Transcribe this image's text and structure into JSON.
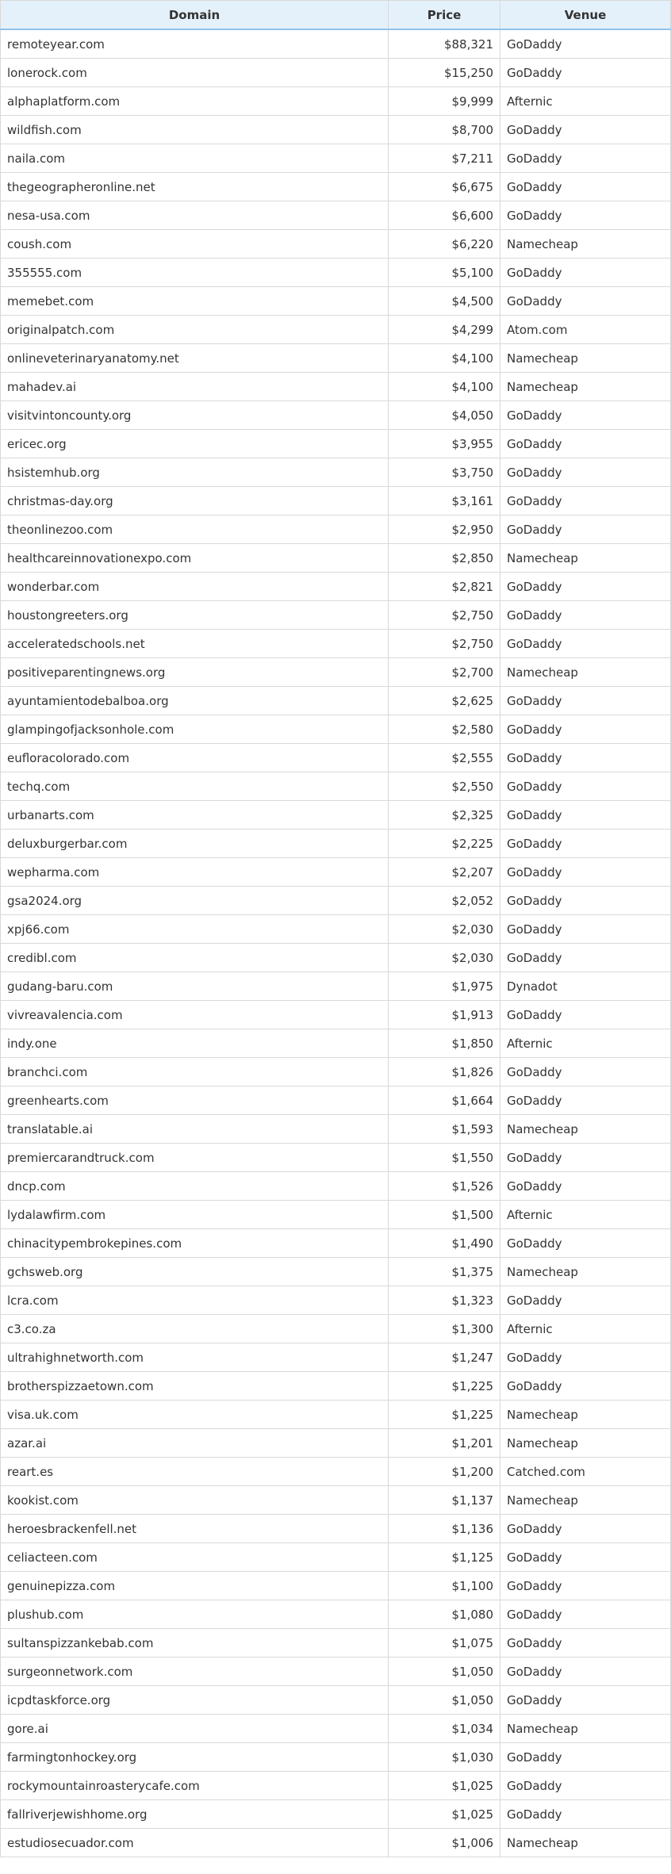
{
  "table": {
    "headers": {
      "domain": "Domain",
      "price": "Price",
      "venue": "Venue"
    },
    "rows": [
      {
        "domain": "remoteyear.com",
        "price": "$88,321",
        "venue": "GoDaddy"
      },
      {
        "domain": "lonerock.com",
        "price": "$15,250",
        "venue": "GoDaddy"
      },
      {
        "domain": "alphaplatform.com",
        "price": "$9,999",
        "venue": "Afternic"
      },
      {
        "domain": "wildfish.com",
        "price": "$8,700",
        "venue": "GoDaddy"
      },
      {
        "domain": "naila.com",
        "price": "$7,211",
        "venue": "GoDaddy"
      },
      {
        "domain": "thegeographeronline.net",
        "price": "$6,675",
        "venue": "GoDaddy"
      },
      {
        "domain": "nesa-usa.com",
        "price": "$6,600",
        "venue": "GoDaddy"
      },
      {
        "domain": "coush.com",
        "price": "$6,220",
        "venue": "Namecheap"
      },
      {
        "domain": "355555.com",
        "price": "$5,100",
        "venue": "GoDaddy"
      },
      {
        "domain": "memebet.com",
        "price": "$4,500",
        "venue": "GoDaddy"
      },
      {
        "domain": "originalpatch.com",
        "price": "$4,299",
        "venue": "Atom.com"
      },
      {
        "domain": "onlineveterinaryanatomy.net",
        "price": "$4,100",
        "venue": "Namecheap"
      },
      {
        "domain": "mahadev.ai",
        "price": "$4,100",
        "venue": "Namecheap"
      },
      {
        "domain": "visitvintoncounty.org",
        "price": "$4,050",
        "venue": "GoDaddy"
      },
      {
        "domain": "ericec.org",
        "price": "$3,955",
        "venue": "GoDaddy"
      },
      {
        "domain": "hsistemhub.org",
        "price": "$3,750",
        "venue": "GoDaddy"
      },
      {
        "domain": "christmas-day.org",
        "price": "$3,161",
        "venue": "GoDaddy"
      },
      {
        "domain": "theonlinezoo.com",
        "price": "$2,950",
        "venue": "GoDaddy"
      },
      {
        "domain": "healthcareinnovationexpo.com",
        "price": "$2,850",
        "venue": "Namecheap"
      },
      {
        "domain": "wonderbar.com",
        "price": "$2,821",
        "venue": "GoDaddy"
      },
      {
        "domain": "houstongreeters.org",
        "price": "$2,750",
        "venue": "GoDaddy"
      },
      {
        "domain": "acceleratedschools.net",
        "price": "$2,750",
        "venue": "GoDaddy"
      },
      {
        "domain": "positiveparentingnews.org",
        "price": "$2,700",
        "venue": "Namecheap"
      },
      {
        "domain": "ayuntamientodebalboa.org",
        "price": "$2,625",
        "venue": "GoDaddy"
      },
      {
        "domain": "glampingofjacksonhole.com",
        "price": "$2,580",
        "venue": "GoDaddy"
      },
      {
        "domain": "eufloracolorado.com",
        "price": "$2,555",
        "venue": "GoDaddy"
      },
      {
        "domain": "techq.com",
        "price": "$2,550",
        "venue": "GoDaddy"
      },
      {
        "domain": "urbanarts.com",
        "price": "$2,325",
        "venue": "GoDaddy"
      },
      {
        "domain": "deluxburgerbar.com",
        "price": "$2,225",
        "venue": "GoDaddy"
      },
      {
        "domain": "wepharma.com",
        "price": "$2,207",
        "venue": "GoDaddy"
      },
      {
        "domain": "gsa2024.org",
        "price": "$2,052",
        "venue": "GoDaddy"
      },
      {
        "domain": "xpj66.com",
        "price": "$2,030",
        "venue": "GoDaddy"
      },
      {
        "domain": "credibl.com",
        "price": "$2,030",
        "venue": "GoDaddy"
      },
      {
        "domain": "gudang-baru.com",
        "price": "$1,975",
        "venue": "Dynadot"
      },
      {
        "domain": "vivreavalencia.com",
        "price": "$1,913",
        "venue": "GoDaddy"
      },
      {
        "domain": "indy.one",
        "price": "$1,850",
        "venue": "Afternic"
      },
      {
        "domain": "branchci.com",
        "price": "$1,826",
        "venue": "GoDaddy"
      },
      {
        "domain": "greenhearts.com",
        "price": "$1,664",
        "venue": "GoDaddy"
      },
      {
        "domain": "translatable.ai",
        "price": "$1,593",
        "venue": "Namecheap"
      },
      {
        "domain": "premiercarandtruck.com",
        "price": "$1,550",
        "venue": "GoDaddy"
      },
      {
        "domain": "dncp.com",
        "price": "$1,526",
        "venue": "GoDaddy"
      },
      {
        "domain": "lydalawfirm.com",
        "price": "$1,500",
        "venue": "Afternic"
      },
      {
        "domain": "chinacitypembrokepines.com",
        "price": "$1,490",
        "venue": "GoDaddy"
      },
      {
        "domain": "gchsweb.org",
        "price": "$1,375",
        "venue": "Namecheap"
      },
      {
        "domain": "lcra.com",
        "price": "$1,323",
        "venue": "GoDaddy"
      },
      {
        "domain": "c3.co.za",
        "price": "$1,300",
        "venue": "Afternic"
      },
      {
        "domain": "ultrahighnetworth.com",
        "price": "$1,247",
        "venue": "GoDaddy"
      },
      {
        "domain": "brotherspizzaetown.com",
        "price": "$1,225",
        "venue": "GoDaddy"
      },
      {
        "domain": "visa.uk.com",
        "price": "$1,225",
        "venue": "Namecheap"
      },
      {
        "domain": "azar.ai",
        "price": "$1,201",
        "venue": "Namecheap"
      },
      {
        "domain": "reart.es",
        "price": "$1,200",
        "venue": "Catched.com"
      },
      {
        "domain": "kookist.com",
        "price": "$1,137",
        "venue": "Namecheap"
      },
      {
        "domain": "heroesbrackenfell.net",
        "price": "$1,136",
        "venue": "GoDaddy"
      },
      {
        "domain": "celiacteen.com",
        "price": "$1,125",
        "venue": "GoDaddy"
      },
      {
        "domain": "genuinepizza.com",
        "price": "$1,100",
        "venue": "GoDaddy"
      },
      {
        "domain": "plushub.com",
        "price": "$1,080",
        "venue": "GoDaddy"
      },
      {
        "domain": "sultanspizzankebab.com",
        "price": "$1,075",
        "venue": "GoDaddy"
      },
      {
        "domain": "surgeonnetwork.com",
        "price": "$1,050",
        "venue": "GoDaddy"
      },
      {
        "domain": "icpdtaskforce.org",
        "price": "$1,050",
        "venue": "GoDaddy"
      },
      {
        "domain": "gore.ai",
        "price": "$1,034",
        "venue": "Namecheap"
      },
      {
        "domain": "farmingtonhockey.org",
        "price": "$1,030",
        "venue": "GoDaddy"
      },
      {
        "domain": "rockymountainroasterycafe.com",
        "price": "$1,025",
        "venue": "GoDaddy"
      },
      {
        "domain": "fallriverjewishhome.org",
        "price": "$1,025",
        "venue": "GoDaddy"
      },
      {
        "domain": "estudiosecuador.com",
        "price": "$1,006",
        "venue": "Namecheap"
      }
    ]
  }
}
